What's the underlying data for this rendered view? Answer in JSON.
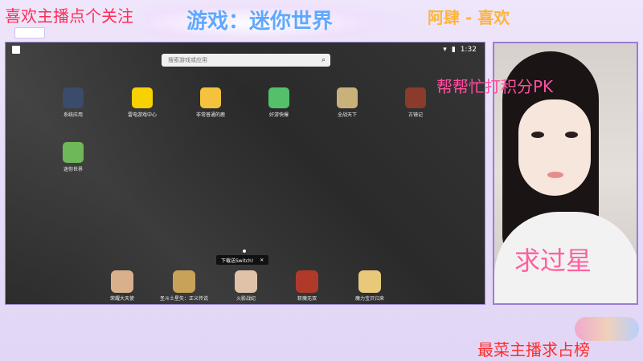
{
  "overlay": {
    "follow_text": "喜欢主播点个关注",
    "game_text": "游戏：迷你世界",
    "thanks_text": "阿肆 - 喜欢",
    "pk_text": "帮帮忙打积分PK",
    "star_text": "求过星",
    "rank_text": "最菜主播求占榜"
  },
  "emulator": {
    "time": "1:32",
    "search_placeholder": "搜索游戏或应用",
    "apps": [
      {
        "label": "系统应用",
        "color": "#3b4b6b"
      },
      {
        "label": "雷电游戏中心",
        "color": "#f7d100"
      },
      {
        "label": "非常普通的鹿",
        "color": "#f4c23c"
      },
      {
        "label": "好游快爆",
        "color": "#55c06a"
      },
      {
        "label": "全战天下",
        "color": "#c9b27a"
      },
      {
        "label": "古镜记",
        "color": "#8a3b2a"
      },
      {
        "label": "迷你世界",
        "color": "#6fb85a"
      }
    ],
    "toast_text": "下载送Switch!",
    "toast_close": "✕",
    "dock": [
      {
        "label": "荣耀大天使",
        "color": "#d9b08c"
      },
      {
        "label": "圣斗士星矢：正义传说",
        "color": "#c9a25a"
      },
      {
        "label": "火影战纪",
        "color": "#e0c2a8"
      },
      {
        "label": "斩魔无双",
        "color": "#b03a2a"
      },
      {
        "label": "魔力宝贝归来",
        "color": "#e8c879"
      }
    ]
  }
}
